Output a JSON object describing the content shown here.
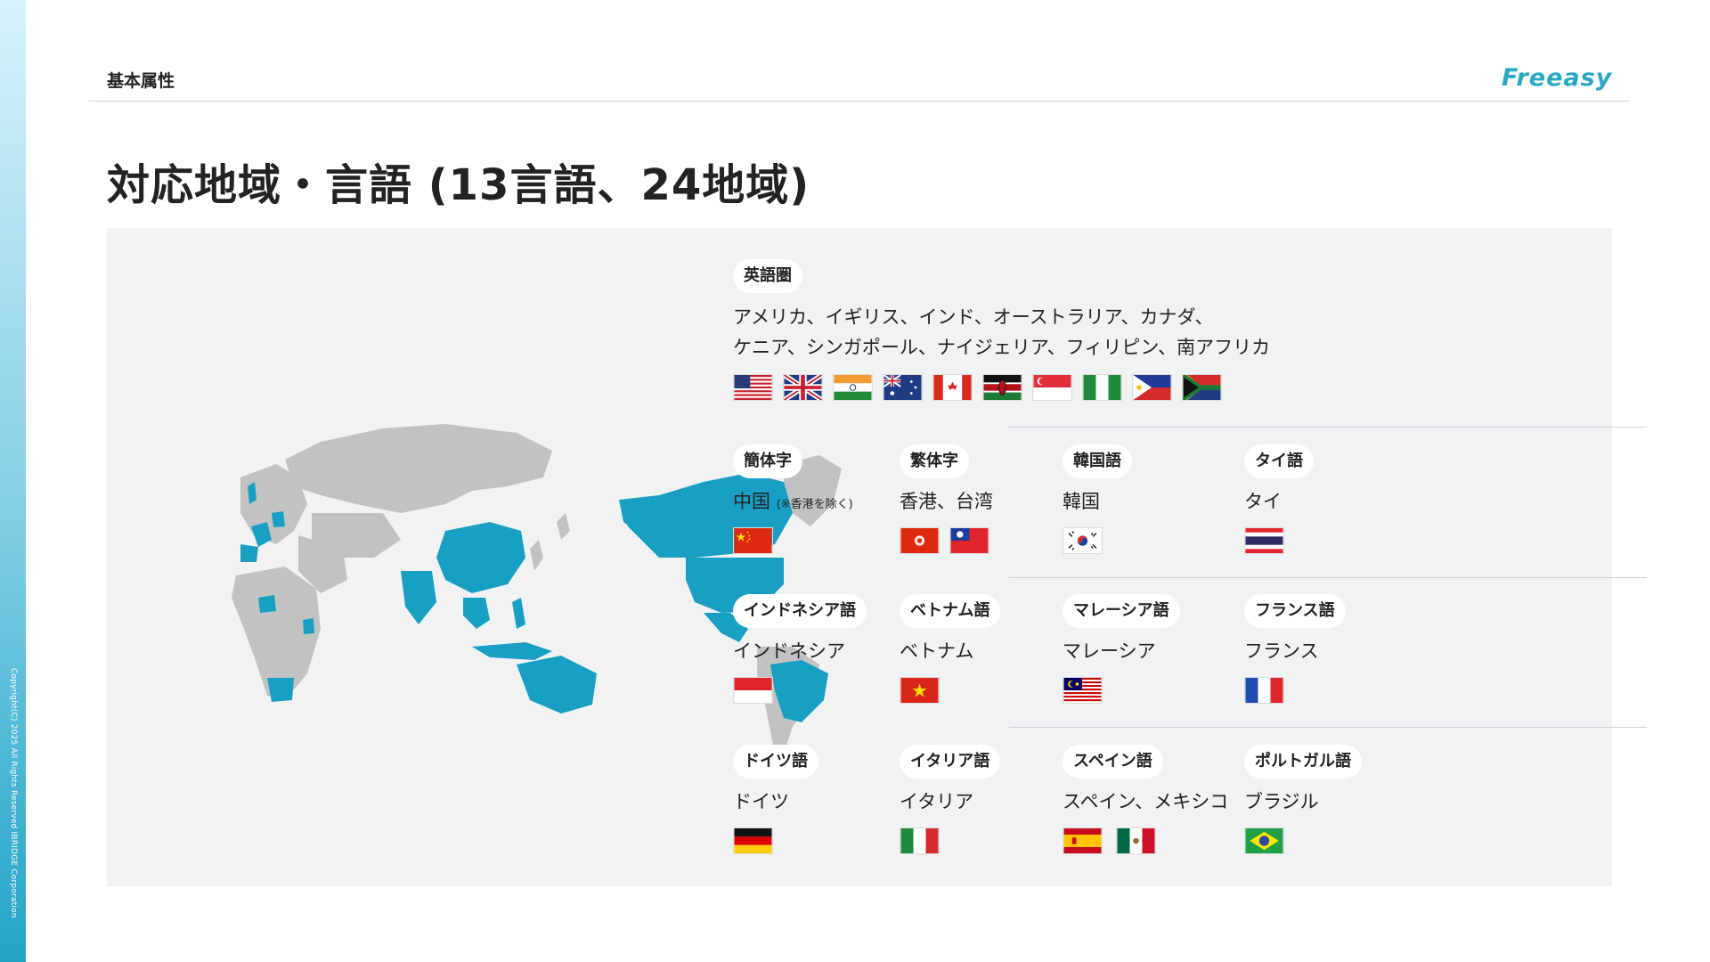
{
  "header": {
    "label": "基本属性",
    "logo": "Freeasy"
  },
  "copyright": "Copyright(C) 2025 All Rights Reserved IBRIDGE Corporation",
  "title": "対応地域・言語 (13言語、24地域)",
  "colors": {
    "highlight": "#1a9fc4",
    "land": "#c2c2c2",
    "panel": "#f1f2f4",
    "accent": "#2aa7c6"
  },
  "english": {
    "tag": "英語圏",
    "line1": "アメリカ、イギリス、インド、オーストラリア、カナダ、",
    "line2": "ケニア、シンガポール、ナイジェリア、フィリピン、南アフリカ",
    "flags": [
      "us-flag",
      "uk-flag",
      "india-flag",
      "australia-flag",
      "canada-flag",
      "kenya-flag",
      "singapore-flag",
      "nigeria-flag",
      "philippines-flag",
      "south-africa-flag"
    ]
  },
  "languages": [
    {
      "tag": "簡体字",
      "region": "中国",
      "note": "(※香港を除く)",
      "flags": [
        "china-flag"
      ]
    },
    {
      "tag": "繁体字",
      "region": "香港、台湾",
      "flags": [
        "hong-kong-flag",
        "taiwan-flag"
      ]
    },
    {
      "tag": "韓国語",
      "region": "韓国",
      "flags": [
        "korea-flag"
      ]
    },
    {
      "tag": "タイ語",
      "region": "タイ",
      "flags": [
        "thailand-flag"
      ]
    },
    {
      "tag": "インドネシア語",
      "region": "インドネシア",
      "flags": [
        "indonesia-flag"
      ]
    },
    {
      "tag": "ベトナム語",
      "region": "ベトナム",
      "flags": [
        "vietnam-flag"
      ]
    },
    {
      "tag": "マレーシア語",
      "region": "マレーシア",
      "flags": [
        "malaysia-flag"
      ]
    },
    {
      "tag": "フランス語",
      "region": "フランス",
      "flags": [
        "france-flag"
      ]
    },
    {
      "tag": "ドイツ語",
      "region": "ドイツ",
      "flags": [
        "germany-flag"
      ]
    },
    {
      "tag": "イタリア語",
      "region": "イタリア",
      "flags": [
        "italy-flag"
      ]
    },
    {
      "tag": "スペイン語",
      "region": "スペイン、メキシコ",
      "flags": [
        "spain-flag",
        "mexico-flag"
      ]
    },
    {
      "tag": "ポルトガル語",
      "region": "ブラジル",
      "flags": [
        "brazil-flag"
      ]
    }
  ]
}
